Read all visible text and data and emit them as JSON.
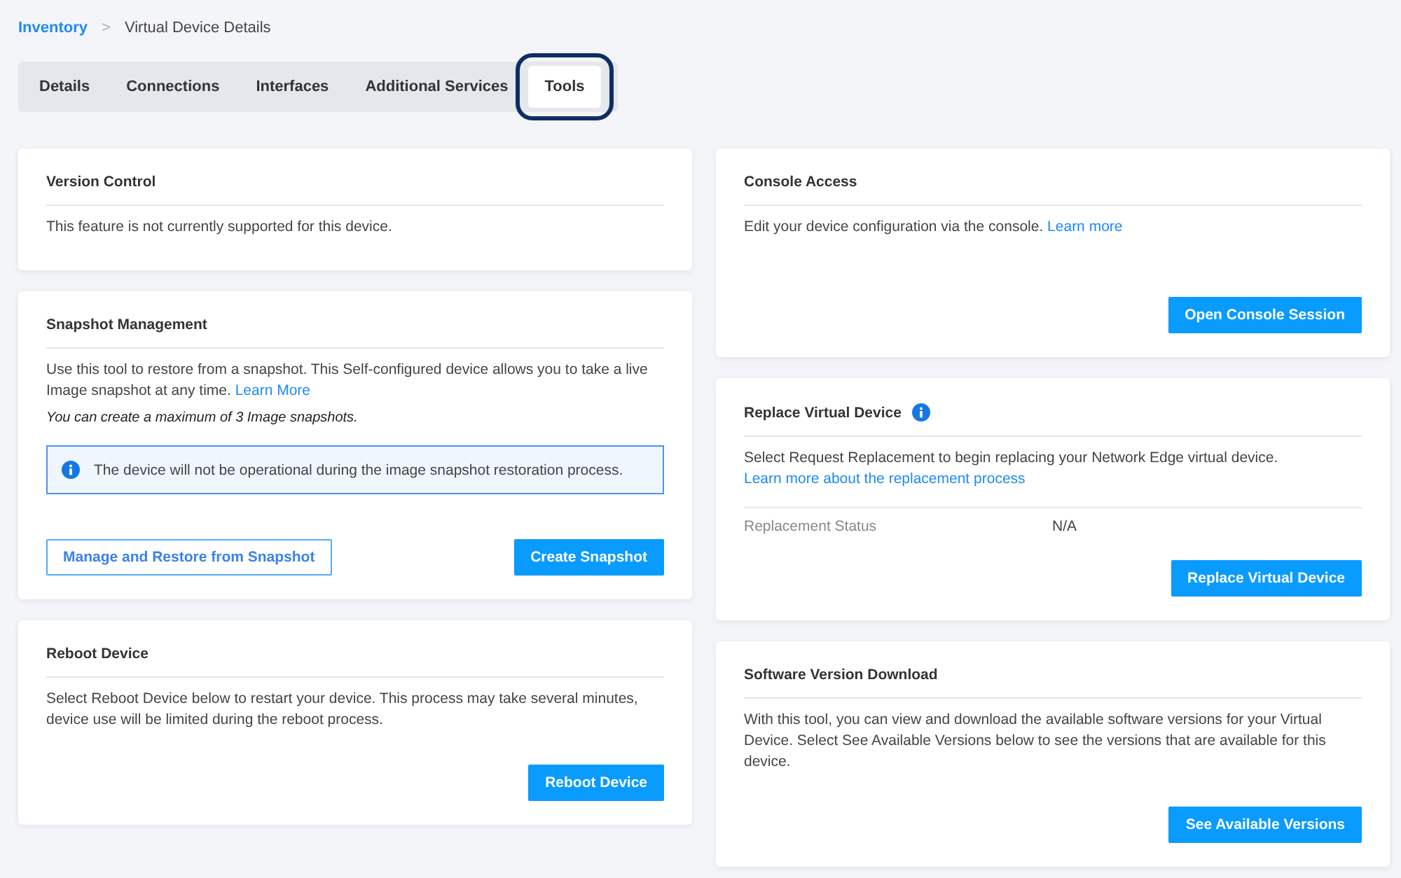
{
  "breadcrumb": {
    "link": "Inventory",
    "separator": ">",
    "current": "Virtual Device Details"
  },
  "tabs": [
    {
      "label": "Details",
      "selected": false
    },
    {
      "label": "Connections",
      "selected": false
    },
    {
      "label": "Interfaces",
      "selected": false
    },
    {
      "label": "Additional Services",
      "selected": false
    },
    {
      "label": "Tools",
      "selected": true
    }
  ],
  "columns": [
    [
      {
        "title": "Version Control",
        "body": [
          {
            "kind": "text",
            "text": "This feature is not currently supported for this device."
          }
        ]
      },
      {
        "title": "Snapshot Management",
        "body": [
          {
            "kind": "text",
            "text": "Use this tool to restore from a snapshot. This Self-configured device allows you to take a live Image snapshot at any time.",
            "link": "Learn More"
          },
          {
            "kind": "note",
            "text": "You can create a maximum of 3 Image snapshots."
          },
          {
            "kind": "alert",
            "text": "The device will not be operational during the image snapshot restoration process."
          }
        ],
        "buttons": [
          {
            "label": "Manage and Restore from Snapshot",
            "kind": "outline"
          },
          {
            "label": "Create Snapshot",
            "kind": "primary"
          }
        ]
      },
      {
        "title": "Reboot Device",
        "body": [
          {
            "kind": "text",
            "text": "Select Reboot Device below to restart your device. This process may take several minutes, device use will be limited during the reboot process."
          }
        ],
        "buttons": [
          {
            "label": "Reboot Device",
            "kind": "primary"
          }
        ]
      }
    ],
    [
      {
        "title": "Console Access",
        "body": [
          {
            "kind": "text",
            "text": "Edit your device configuration via the console.",
            "link": "Learn more"
          }
        ],
        "buttons": [
          {
            "label": "Open Console Session",
            "kind": "primary"
          }
        ]
      },
      {
        "title": "Replace Virtual Device",
        "info": true,
        "body": [
          {
            "kind": "text",
            "text": "Select Request Replacement to begin replacing your Network Edge virtual device.",
            "link": "Learn more about the replacement process"
          },
          {
            "kind": "field",
            "label": "Replacement Status",
            "value": "N/A"
          }
        ],
        "buttons": [
          {
            "label": "Replace Virtual Device",
            "kind": "primary"
          }
        ]
      },
      {
        "title": "Software Version Download",
        "body": [
          {
            "kind": "text",
            "text": "With this tool, you can view and download the available software versions for your Virtual Device. Select See Available Versions below to see the versions that are available for this device."
          }
        ],
        "buttons": [
          {
            "label": "See Available Versions",
            "kind": "primary"
          }
        ]
      }
    ]
  ]
}
